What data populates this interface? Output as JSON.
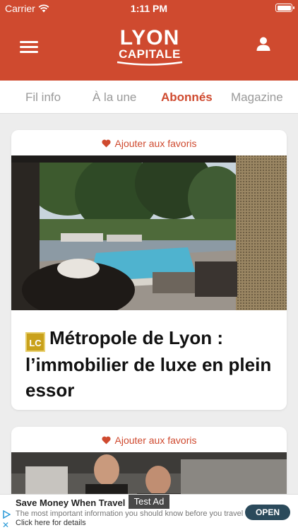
{
  "status_bar": {
    "carrier": "Carrier",
    "time": "1:11 PM"
  },
  "header": {
    "logo_line1": "LYON",
    "logo_line2": "CAPITALE",
    "accent_color": "#cf4a2f"
  },
  "tabs": [
    {
      "label": "Fil info",
      "active": false
    },
    {
      "label": "À la une",
      "active": false
    },
    {
      "label": "Abonnés",
      "active": true
    },
    {
      "label": "Magazine",
      "active": false
    }
  ],
  "articles": [
    {
      "favorite_label": "Ajouter aux favoris",
      "badge": "LC",
      "title": "Métropole de Lyon : l’immobilier de luxe en plein essor"
    },
    {
      "favorite_label": "Ajouter aux favoris"
    }
  ],
  "ad": {
    "badge": "Test Ad",
    "title": "Save Money When Travel",
    "description": "The most important information you should know before you travel",
    "link": "Click here for details",
    "cta": "OPEN"
  },
  "icons": [
    "wifi-icon",
    "battery-icon",
    "hamburger-menu-icon",
    "user-icon",
    "heart-icon",
    "ad-play-icon",
    "close-icon"
  ]
}
